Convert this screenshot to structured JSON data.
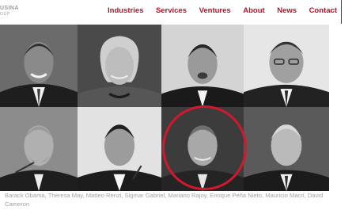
{
  "logo": {
    "main": "USINA",
    "sub": "OUP"
  },
  "nav": {
    "items": [
      "Industries",
      "Services",
      "Ventures",
      "About",
      "News",
      "Contact"
    ]
  },
  "portraits": {
    "caption": "Barack Obama, Theresa May, Matteo Renzi, Sigmar Gabriel, Mariano Rajoy, Enrique Peña Nieto, Mauricio Macri, David Cameron"
  },
  "colors": {
    "accent": "#b7122c",
    "highlight": "#d2182d",
    "caption_text": "#a3a3a3"
  }
}
